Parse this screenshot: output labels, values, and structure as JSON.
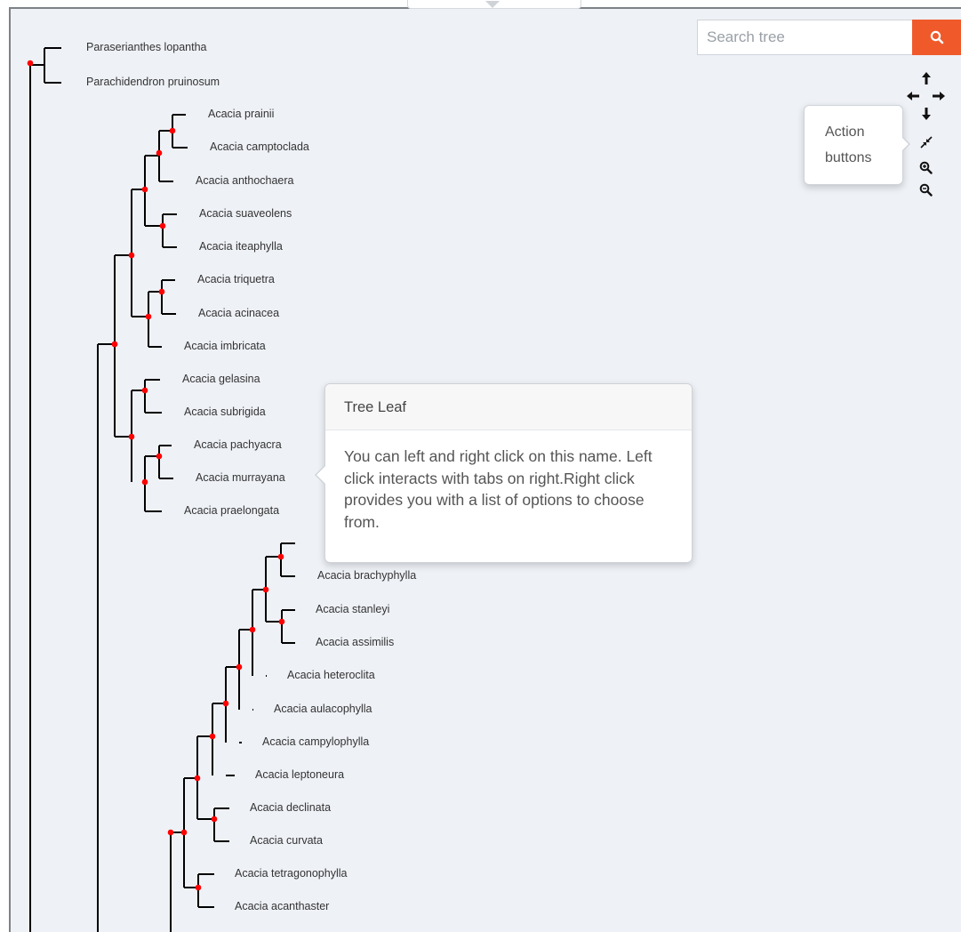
{
  "search": {
    "placeholder": "Search tree",
    "button_icon": "search-icon"
  },
  "action_buttons": {
    "icons": [
      "arrow-up-icon",
      "arrow-left-icon",
      "arrow-right-icon",
      "arrow-down-icon",
      "compress-icon",
      "zoom-in-icon",
      "zoom-out-icon"
    ],
    "tooltip_line1": "Action",
    "tooltip_line2": "buttons"
  },
  "popover": {
    "title": "Tree Leaf",
    "body": "You can left and right click on this name. Left click interacts with tabs on right.Right click provides you with a list of options to choose from."
  },
  "colors": {
    "node": "#ff0000",
    "branch": "#000000",
    "search_button": "#f05a2b",
    "panel_bg": "#eef1f6"
  },
  "tree": {
    "leaves": [
      "Paraserianthes lopantha",
      "Parachidendron pruinosum",
      "Acacia prainii",
      "Acacia camptoclada",
      "Acacia anthochaera",
      "Acacia suaveolens",
      "Acacia iteaphylla",
      "Acacia triquetra",
      "Acacia acinacea",
      "Acacia imbricata",
      "Acacia gelasina",
      "Acacia subrigida",
      "Acacia pachyacra",
      "Acacia murrayana",
      "Acacia praelongata",
      "Acacia brachyphylla",
      "Acacia stanleyi",
      "Acacia assimilis",
      "Acacia heteroclita",
      "Acacia aulacophylla",
      "Acacia campylophylla",
      "Acacia leptoneura",
      "Acacia declinata",
      "Acacia curvata",
      "Acacia tetragonophylla",
      "Acacia acanthaster"
    ]
  }
}
